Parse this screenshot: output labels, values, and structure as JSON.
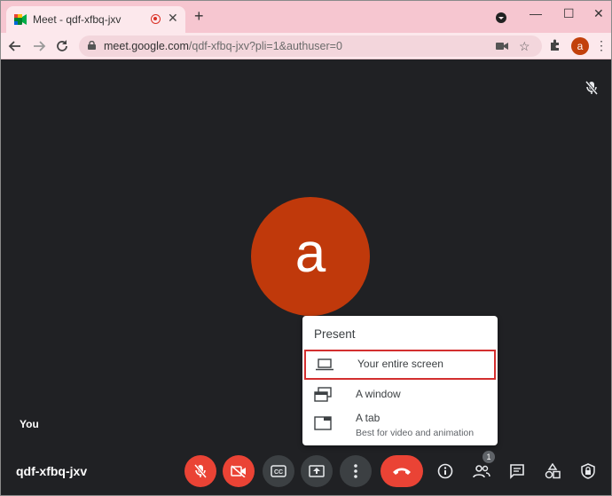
{
  "browser": {
    "tab_title": "Meet - qdf-xfbq-jxv",
    "tab_close": "✕",
    "new_tab": "+",
    "window_minimize": "—",
    "window_maximize": "☐",
    "window_close": "✕",
    "url_host": "meet.google.com",
    "url_path": "/qdf-xfbq-jxv?pli=1&authuser=0",
    "profile_initial": "a",
    "accent": "#f6c6d0"
  },
  "meet": {
    "participant_initial": "a",
    "self_label": "You",
    "meeting_code": "qdf-xfbq-jxv",
    "people_count": "1"
  },
  "present_menu": {
    "title": "Present",
    "items": [
      {
        "label": "Your entire screen",
        "icon": "laptop-icon"
      },
      {
        "label": "A window",
        "icon": "window-icon"
      },
      {
        "label": "A tab",
        "sublabel": "Best for video and animation",
        "icon": "tab-icon"
      }
    ]
  },
  "colors": {
    "end_call": "#ea4335",
    "avatar": "#c0390b",
    "highlight_border": "#d32f2f"
  }
}
